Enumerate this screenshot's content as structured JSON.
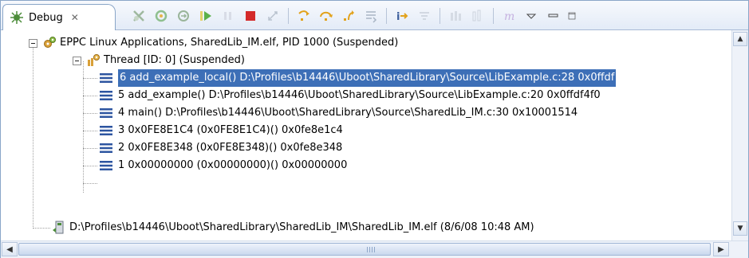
{
  "view": {
    "tab_label": "Debug",
    "tab_close": "✕",
    "tab_icon": "debug-bug-icon"
  },
  "toolbar": {
    "items": [
      "remove-all-terminated-icon",
      "connect-icon",
      "disconnect-icon",
      "resume-icon",
      "suspend-icon",
      "terminate-icon",
      "disconnect-target-icon",
      "step-into-icon",
      "step-over-icon",
      "step-return-icon",
      "drop-to-frame-icon",
      "instruction-stepping-mode-icon",
      "use-step-filters-icon",
      "multicore-group-icon",
      "multicore-ungroup-icon",
      "italic-m-icon",
      "view-menu-icon",
      "minimize-icon",
      "maximize-icon"
    ]
  },
  "tree": {
    "launch": "EPPC Linux Applications, SharedLib_IM.elf, PID 1000 (Suspended)",
    "thread": "Thread [ID: 0] (Suspended)",
    "frames": [
      "6 add_example_local() D:\\Profiles\\b14446\\Uboot\\SharedLibrary\\Source\\LibExample.c:28 0x0ffdf",
      "5 add_example() D:\\Profiles\\b14446\\Uboot\\SharedLibrary\\Source\\LibExample.c:20 0x0ffdf4f0",
      "4 main() D:\\Profiles\\b14446\\Uboot\\SharedLibrary\\Source\\SharedLib_IM.c:30 0x10001514",
      "3 0x0FE8E1C4 (0x0FE8E1C4)()  0x0fe8e1c4",
      "2 0x0FE8E348 (0x0FE8E348)()  0x0fe8e348",
      "1 0x00000000 (0x00000000)()  0x00000000"
    ],
    "process": "D:\\Profiles\\b14446\\Uboot\\SharedLibrary\\SharedLib_IM\\SharedLib_IM.elf (8/6/08 10:48 AM)"
  },
  "scrollbars": {
    "up": "▲",
    "down": "▼",
    "left": "◀",
    "right": "▶"
  },
  "colors": {
    "selection": "#3d6fb7",
    "border": "#8aa6c8"
  }
}
